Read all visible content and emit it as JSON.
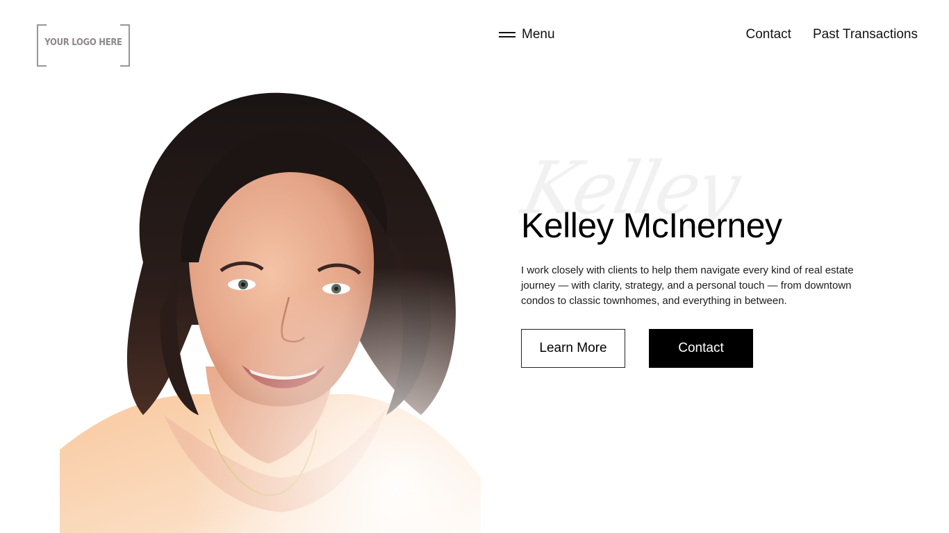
{
  "logo": {
    "text": "YOUR LOGO HERE"
  },
  "nav": {
    "menu_icon": "hamburger-menu-icon",
    "menu_label": "Menu",
    "links": [
      "Contact",
      "Past Transactions"
    ]
  },
  "hero": {
    "script_watermark": "Kelley",
    "name": "Kelley McInerney",
    "description": "I work closely with clients to help them navigate every kind of real estate journey — with clarity, strategy, and a personal touch — from downtown condos to classic townhomes, and everything in between.",
    "learn_more_label": "Learn More",
    "contact_label": "Contact"
  },
  "portrait": {
    "subject": "portrait photo of a smiling woman with dark shoulder-length hair and a peach top"
  },
  "colors": {
    "background": "#ffffff",
    "text": "#000000",
    "primary_button": "#000000",
    "logo_gray": "#8e8789"
  }
}
